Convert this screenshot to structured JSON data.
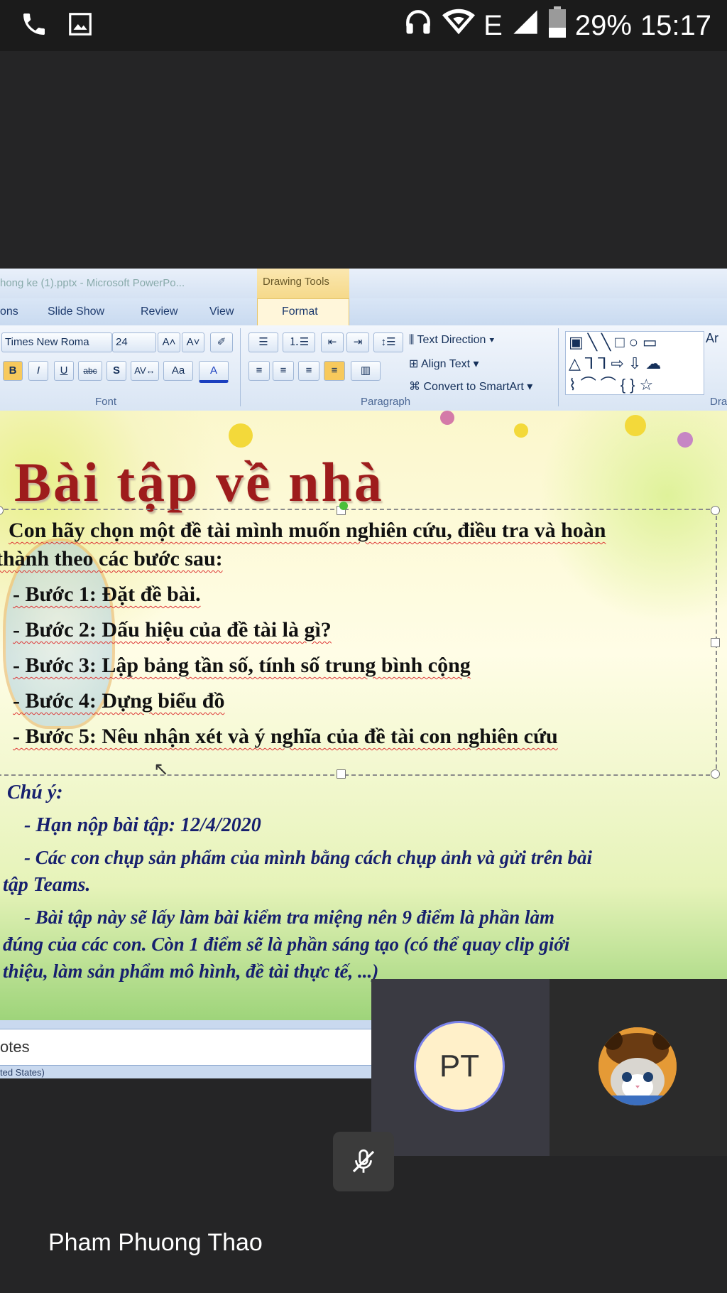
{
  "status_bar": {
    "left_icons": [
      "phone-icon",
      "image-icon"
    ],
    "right_icons": [
      "headset-icon",
      "wifi-icon",
      "signal-icon",
      "battery-icon"
    ],
    "network_type": "E",
    "battery_percent": "29%",
    "time": "15:17"
  },
  "powerpoint": {
    "window_title": "hong ke (1).pptx - Microsoft PowerPo...",
    "contextual_tab_group": "Drawing Tools",
    "tabs": [
      "ons",
      "Slide Show",
      "Review",
      "View",
      "Format"
    ],
    "font_name": "Times New Roma",
    "font_size": "24",
    "text_direction_label": "Text Direction",
    "align_text_label": "Align Text",
    "convert_smartart_label": "Convert to SmartArt",
    "group_font": "Font",
    "group_paragraph": "Paragraph",
    "group_drawing": "Dra",
    "notes_label": "otes",
    "language_status": "ted States)"
  },
  "slide": {
    "title": "Bài tập về nhà",
    "intro_line1": "Con hãy chọn một đề tài mình muốn nghiên cứu, điều tra và hoàn",
    "intro_line2": "thành theo các bước sau:",
    "steps": [
      "- Bước 1: Đặt đề bài.",
      "- Bước 2: Dấu hiệu của đề tài là gì?",
      "- Bước 3: Lập bảng tần số, tính số trung bình cộng",
      "- Bước 4: Dựng biểu đồ",
      "- Bước 5: Nêu nhận xét và ý nghĩa của đề tài con nghiên cứu"
    ],
    "note_heading": "Chú ý:",
    "note_lines": [
      "- Hạn nộp bài tập: 12/4/2020",
      "- Các con chụp sản phẩm của mình bằng cách chụp ảnh và gửi trên bài",
      "tập Teams.",
      "- Bài tập này sẽ lấy làm bài kiểm tra miệng nên 9 điểm là phần làm",
      "đúng của các con. Còn 1 điểm sẽ là phần sáng tạo (có thể quay clip giới",
      "thiệu, làm sản phẩm  mô hình, đề tài thực tế, ...)"
    ]
  },
  "participants": {
    "pt_initials": "PT",
    "cat_avatar": "cat-avatar-image"
  },
  "controls": {
    "mute_icon": "mic-off-icon"
  },
  "user_name": "Pham Phuong Thao",
  "colors": {
    "background": "#252526",
    "avatar_ring": "#7b83eb",
    "avatar_fill": "#fff0c9",
    "slide_title": "#9e1c1c"
  }
}
